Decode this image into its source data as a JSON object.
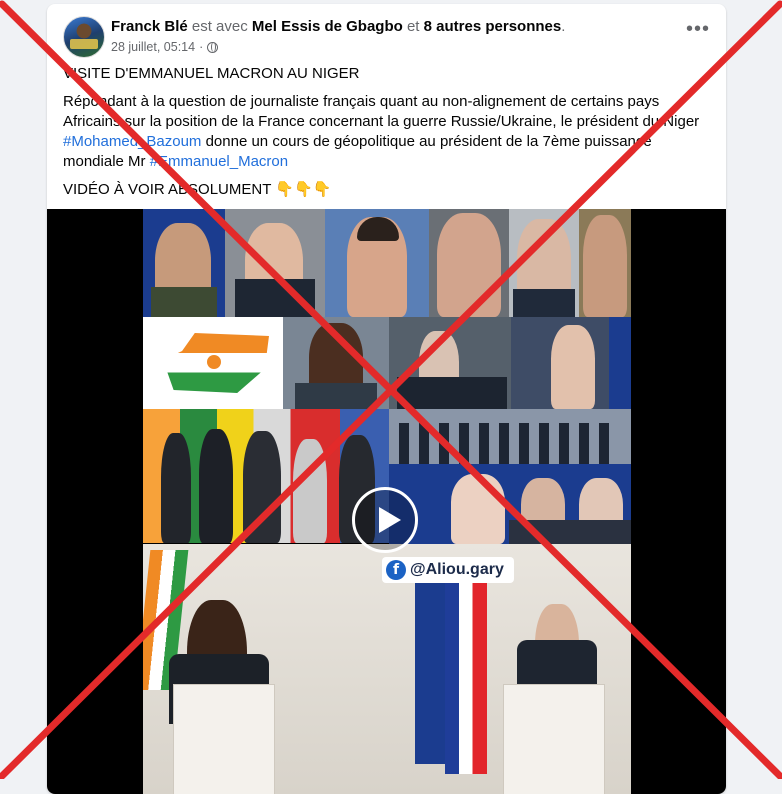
{
  "post": {
    "author": "Franck Blé",
    "with_text": "est avec",
    "tagged": "Mel Essis de Gbagbo",
    "and_text": "et",
    "others": "8 autres personnes",
    "period": ".",
    "date": "28 juillet, 05:14",
    "separator": "·",
    "more_label": "•••",
    "title": "VISITE D'EMMANUEL MACRON AU NIGER",
    "body_1": "Répondant à la question de journaliste français quant au non-alignement de certains pays Africains sur la position de la France concernant la guerre Russie/Ukraine, le président du Niger ",
    "hashtag_1": "#Mohamed_Bazoum",
    "body_2": " donne un cours de géopolitique au président de la 7ème puissance mondiale Mr ",
    "hashtag_2": "#Emmanuel_Macron",
    "cta": "VIDÉO À VOIR ABSOLUMENT 👇👇👇"
  },
  "video": {
    "watermark": "@Aliou.gary",
    "fb_glyph": "f"
  },
  "overlay": {
    "cross_color": "#e32a2a"
  }
}
